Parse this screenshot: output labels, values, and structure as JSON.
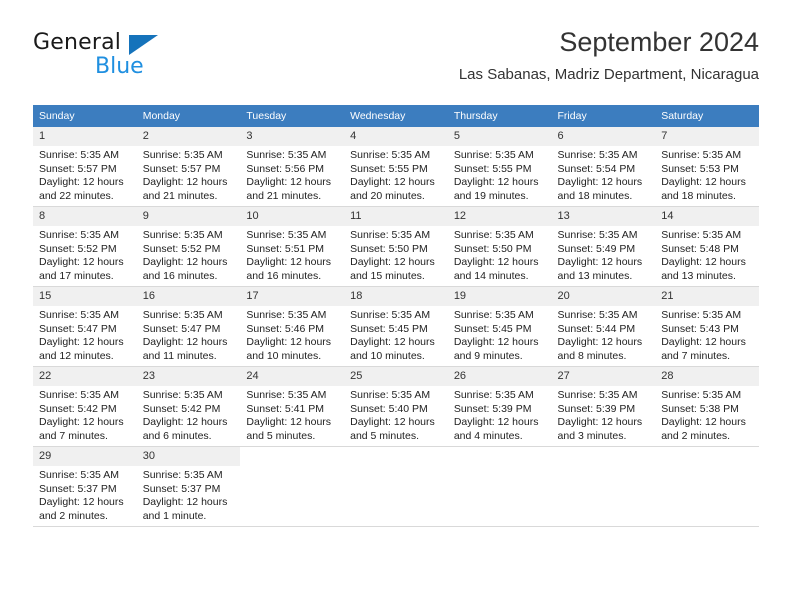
{
  "brand": {
    "name_part1": "General",
    "name_part2": "Blue",
    "triangle_color": "#1573bb",
    "blue_text_color": "#1f8fe0"
  },
  "header": {
    "title": "September 2024",
    "subtitle": "Las Sabanas, Madriz Department, Nicaragua"
  },
  "theme": {
    "header_row_bg": "#3C7DBF",
    "header_row_text": "#ffffff",
    "daynum_bg": "#F0F0F0",
    "row_divider": "#d9d9d9"
  },
  "weekdays": [
    "Sunday",
    "Monday",
    "Tuesday",
    "Wednesday",
    "Thursday",
    "Friday",
    "Saturday"
  ],
  "weeks": [
    [
      {
        "day": "1",
        "sunrise": "Sunrise: 5:35 AM",
        "sunset": "Sunset: 5:57 PM",
        "daylight_line1": "Daylight: 12 hours",
        "daylight_line2": "and 22 minutes."
      },
      {
        "day": "2",
        "sunrise": "Sunrise: 5:35 AM",
        "sunset": "Sunset: 5:57 PM",
        "daylight_line1": "Daylight: 12 hours",
        "daylight_line2": "and 21 minutes."
      },
      {
        "day": "3",
        "sunrise": "Sunrise: 5:35 AM",
        "sunset": "Sunset: 5:56 PM",
        "daylight_line1": "Daylight: 12 hours",
        "daylight_line2": "and 21 minutes."
      },
      {
        "day": "4",
        "sunrise": "Sunrise: 5:35 AM",
        "sunset": "Sunset: 5:55 PM",
        "daylight_line1": "Daylight: 12 hours",
        "daylight_line2": "and 20 minutes."
      },
      {
        "day": "5",
        "sunrise": "Sunrise: 5:35 AM",
        "sunset": "Sunset: 5:55 PM",
        "daylight_line1": "Daylight: 12 hours",
        "daylight_line2": "and 19 minutes."
      },
      {
        "day": "6",
        "sunrise": "Sunrise: 5:35 AM",
        "sunset": "Sunset: 5:54 PM",
        "daylight_line1": "Daylight: 12 hours",
        "daylight_line2": "and 18 minutes."
      },
      {
        "day": "7",
        "sunrise": "Sunrise: 5:35 AM",
        "sunset": "Sunset: 5:53 PM",
        "daylight_line1": "Daylight: 12 hours",
        "daylight_line2": "and 18 minutes."
      }
    ],
    [
      {
        "day": "8",
        "sunrise": "Sunrise: 5:35 AM",
        "sunset": "Sunset: 5:52 PM",
        "daylight_line1": "Daylight: 12 hours",
        "daylight_line2": "and 17 minutes."
      },
      {
        "day": "9",
        "sunrise": "Sunrise: 5:35 AM",
        "sunset": "Sunset: 5:52 PM",
        "daylight_line1": "Daylight: 12 hours",
        "daylight_line2": "and 16 minutes."
      },
      {
        "day": "10",
        "sunrise": "Sunrise: 5:35 AM",
        "sunset": "Sunset: 5:51 PM",
        "daylight_line1": "Daylight: 12 hours",
        "daylight_line2": "and 16 minutes."
      },
      {
        "day": "11",
        "sunrise": "Sunrise: 5:35 AM",
        "sunset": "Sunset: 5:50 PM",
        "daylight_line1": "Daylight: 12 hours",
        "daylight_line2": "and 15 minutes."
      },
      {
        "day": "12",
        "sunrise": "Sunrise: 5:35 AM",
        "sunset": "Sunset: 5:50 PM",
        "daylight_line1": "Daylight: 12 hours",
        "daylight_line2": "and 14 minutes."
      },
      {
        "day": "13",
        "sunrise": "Sunrise: 5:35 AM",
        "sunset": "Sunset: 5:49 PM",
        "daylight_line1": "Daylight: 12 hours",
        "daylight_line2": "and 13 minutes."
      },
      {
        "day": "14",
        "sunrise": "Sunrise: 5:35 AM",
        "sunset": "Sunset: 5:48 PM",
        "daylight_line1": "Daylight: 12 hours",
        "daylight_line2": "and 13 minutes."
      }
    ],
    [
      {
        "day": "15",
        "sunrise": "Sunrise: 5:35 AM",
        "sunset": "Sunset: 5:47 PM",
        "daylight_line1": "Daylight: 12 hours",
        "daylight_line2": "and 12 minutes."
      },
      {
        "day": "16",
        "sunrise": "Sunrise: 5:35 AM",
        "sunset": "Sunset: 5:47 PM",
        "daylight_line1": "Daylight: 12 hours",
        "daylight_line2": "and 11 minutes."
      },
      {
        "day": "17",
        "sunrise": "Sunrise: 5:35 AM",
        "sunset": "Sunset: 5:46 PM",
        "daylight_line1": "Daylight: 12 hours",
        "daylight_line2": "and 10 minutes."
      },
      {
        "day": "18",
        "sunrise": "Sunrise: 5:35 AM",
        "sunset": "Sunset: 5:45 PM",
        "daylight_line1": "Daylight: 12 hours",
        "daylight_line2": "and 10 minutes."
      },
      {
        "day": "19",
        "sunrise": "Sunrise: 5:35 AM",
        "sunset": "Sunset: 5:45 PM",
        "daylight_line1": "Daylight: 12 hours",
        "daylight_line2": "and 9 minutes."
      },
      {
        "day": "20",
        "sunrise": "Sunrise: 5:35 AM",
        "sunset": "Sunset: 5:44 PM",
        "daylight_line1": "Daylight: 12 hours",
        "daylight_line2": "and 8 minutes."
      },
      {
        "day": "21",
        "sunrise": "Sunrise: 5:35 AM",
        "sunset": "Sunset: 5:43 PM",
        "daylight_line1": "Daylight: 12 hours",
        "daylight_line2": "and 7 minutes."
      }
    ],
    [
      {
        "day": "22",
        "sunrise": "Sunrise: 5:35 AM",
        "sunset": "Sunset: 5:42 PM",
        "daylight_line1": "Daylight: 12 hours",
        "daylight_line2": "and 7 minutes."
      },
      {
        "day": "23",
        "sunrise": "Sunrise: 5:35 AM",
        "sunset": "Sunset: 5:42 PM",
        "daylight_line1": "Daylight: 12 hours",
        "daylight_line2": "and 6 minutes."
      },
      {
        "day": "24",
        "sunrise": "Sunrise: 5:35 AM",
        "sunset": "Sunset: 5:41 PM",
        "daylight_line1": "Daylight: 12 hours",
        "daylight_line2": "and 5 minutes."
      },
      {
        "day": "25",
        "sunrise": "Sunrise: 5:35 AM",
        "sunset": "Sunset: 5:40 PM",
        "daylight_line1": "Daylight: 12 hours",
        "daylight_line2": "and 5 minutes."
      },
      {
        "day": "26",
        "sunrise": "Sunrise: 5:35 AM",
        "sunset": "Sunset: 5:39 PM",
        "daylight_line1": "Daylight: 12 hours",
        "daylight_line2": "and 4 minutes."
      },
      {
        "day": "27",
        "sunrise": "Sunrise: 5:35 AM",
        "sunset": "Sunset: 5:39 PM",
        "daylight_line1": "Daylight: 12 hours",
        "daylight_line2": "and 3 minutes."
      },
      {
        "day": "28",
        "sunrise": "Sunrise: 5:35 AM",
        "sunset": "Sunset: 5:38 PM",
        "daylight_line1": "Daylight: 12 hours",
        "daylight_line2": "and 2 minutes."
      }
    ],
    [
      {
        "day": "29",
        "sunrise": "Sunrise: 5:35 AM",
        "sunset": "Sunset: 5:37 PM",
        "daylight_line1": "Daylight: 12 hours",
        "daylight_line2": "and 2 minutes."
      },
      {
        "day": "30",
        "sunrise": "Sunrise: 5:35 AM",
        "sunset": "Sunset: 5:37 PM",
        "daylight_line1": "Daylight: 12 hours",
        "daylight_line2": "and 1 minute."
      },
      {
        "day": "",
        "sunrise": "",
        "sunset": "",
        "daylight_line1": "",
        "daylight_line2": ""
      },
      {
        "day": "",
        "sunrise": "",
        "sunset": "",
        "daylight_line1": "",
        "daylight_line2": ""
      },
      {
        "day": "",
        "sunrise": "",
        "sunset": "",
        "daylight_line1": "",
        "daylight_line2": ""
      },
      {
        "day": "",
        "sunrise": "",
        "sunset": "",
        "daylight_line1": "",
        "daylight_line2": ""
      },
      {
        "day": "",
        "sunrise": "",
        "sunset": "",
        "daylight_line1": "",
        "daylight_line2": ""
      }
    ]
  ]
}
